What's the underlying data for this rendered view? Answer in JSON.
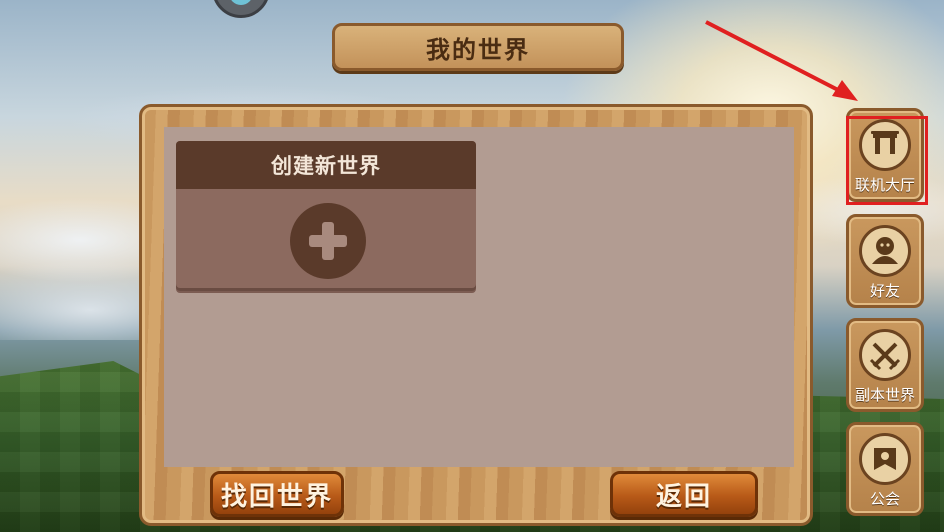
{
  "title": "我的世界",
  "card": {
    "label": "创建新世界",
    "icon": "plus-icon"
  },
  "buttons": {
    "recover": "找回世界",
    "back": "返回"
  },
  "side_menu": [
    {
      "label": "联机大厅",
      "icon": "gate-icon",
      "highlighted": true
    },
    {
      "label": "好友",
      "icon": "friend-icon",
      "highlighted": false
    },
    {
      "label": "副本世界",
      "icon": "crossed-swords-icon",
      "highlighted": false
    },
    {
      "label": "公会",
      "icon": "guild-banner-icon",
      "highlighted": false
    }
  ],
  "annotation": {
    "highlight_color": "#e02020"
  }
}
